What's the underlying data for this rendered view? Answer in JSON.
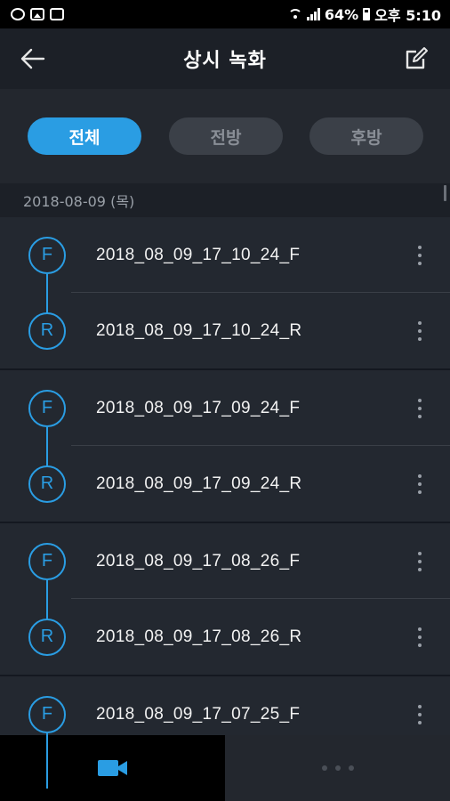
{
  "status_bar": {
    "battery": "64%",
    "time": "오후 5:10",
    "icons": [
      "sync-icon",
      "image-icon",
      "phone-icon",
      "wifi-icon",
      "signal-icon",
      "battery-icon"
    ]
  },
  "header": {
    "title": "상시 녹화",
    "back_icon": "back-arrow-icon",
    "edit_icon": "edit-icon"
  },
  "filters": {
    "all": "전체",
    "front": "전방",
    "rear": "후방",
    "selected": "전체"
  },
  "date_header": "2018-08-09 (목)",
  "recordings": [
    {
      "front": {
        "badge": "F",
        "name": "2018_08_09_17_10_24_F"
      },
      "rear": {
        "badge": "R",
        "name": "2018_08_09_17_10_24_R"
      }
    },
    {
      "front": {
        "badge": "F",
        "name": "2018_08_09_17_09_24_F"
      },
      "rear": {
        "badge": "R",
        "name": "2018_08_09_17_09_24_R"
      }
    },
    {
      "front": {
        "badge": "F",
        "name": "2018_08_09_17_08_26_F"
      },
      "rear": {
        "badge": "R",
        "name": "2018_08_09_17_08_26_R"
      }
    },
    {
      "front": {
        "badge": "F",
        "name": "2018_08_09_17_07_25_F"
      }
    }
  ],
  "bottom_nav": {
    "tabs": [
      "video-camera-icon",
      "more-dots-icon"
    ],
    "active": "video-camera-icon"
  },
  "colors": {
    "accent": "#2a9de3",
    "background": "#232830",
    "header": "#1c2027",
    "inactive_pill": "#3b4048"
  }
}
